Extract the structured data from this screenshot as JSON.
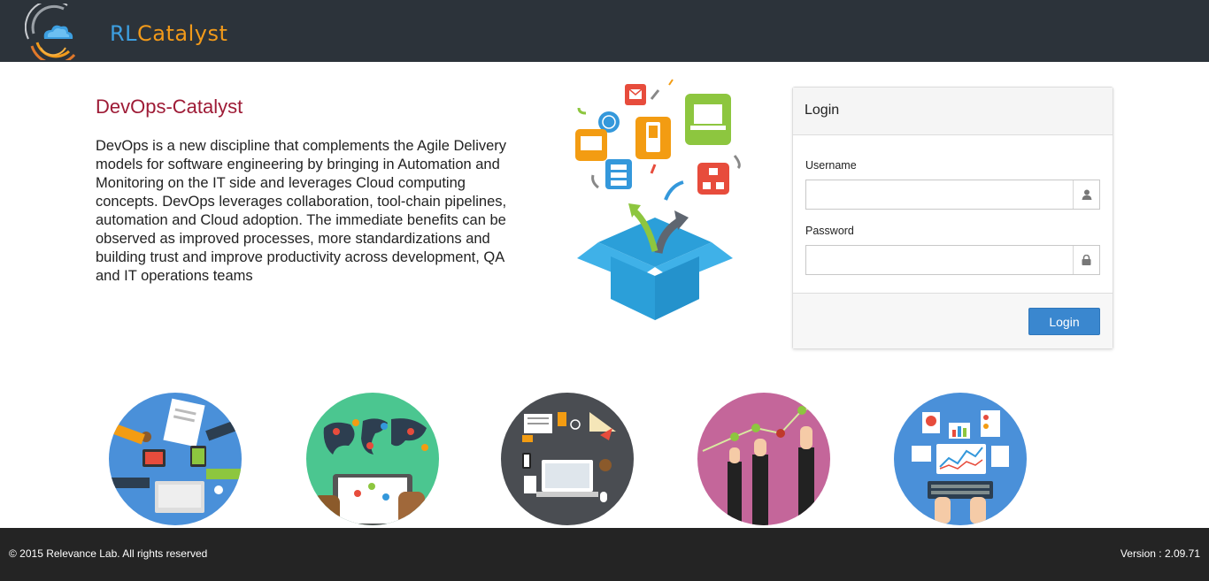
{
  "header": {
    "logo_prefix": "RL",
    "logo_suffix": "Catalyst",
    "logo_icon": "cloud-swirl-logo-icon"
  },
  "intro": {
    "title": "DevOps-Catalyst",
    "body": "DevOps is a new discipline that complements the Agile Delivery models for software engineering by bringing in Automation and Monitoring on the IT side and leverages Cloud computing concepts. DevOps leverages collaboration, tool-chain pipelines, automation and Cloud adoption. The immediate benefits can be observed as improved processes, more standardizations and building trust and improve productivity across development, QA and IT operations teams"
  },
  "login": {
    "heading": "Login",
    "username_label": "Username",
    "username_value": "",
    "username_icon": "user-icon",
    "password_label": "Password",
    "password_value": "",
    "password_icon": "lock-icon",
    "button_label": "Login"
  },
  "features": [
    {
      "icon": "team-collaboration-icon",
      "color": "#4a90d9"
    },
    {
      "icon": "world-map-tablet-icon",
      "color": "#4bc690"
    },
    {
      "icon": "workspace-laptop-icon",
      "color": "#4a4d52"
    },
    {
      "icon": "growth-chart-hands-icon",
      "color": "#c4669a"
    },
    {
      "icon": "analytics-dashboard-icon",
      "color": "#4a90d9"
    }
  ],
  "colors": {
    "topbar": "#2c333a",
    "title": "#9e1b36",
    "button": "#3a87cf",
    "footer": "#242424"
  },
  "footer": {
    "copyright": "© 2015 Relevance Lab. All rights reserved",
    "version": "Version : 2.09.71"
  }
}
